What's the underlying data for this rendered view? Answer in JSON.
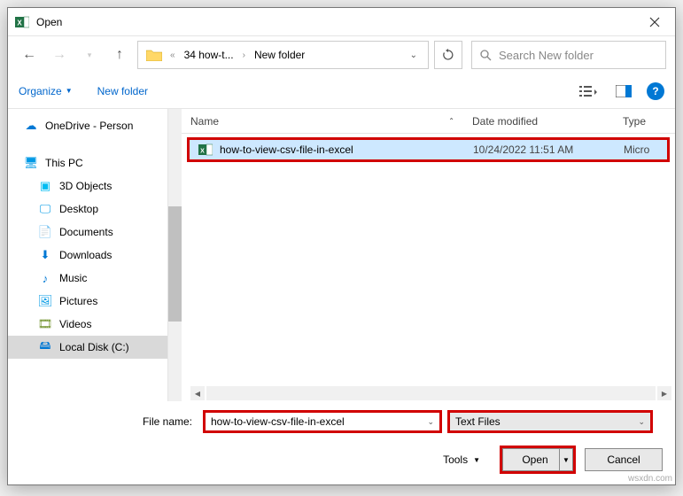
{
  "title": "Open",
  "breadcrumb": {
    "p1": "34 how-t...",
    "p2": "New folder"
  },
  "search": {
    "placeholder": "Search New folder"
  },
  "toolbar": {
    "organize": "Organize",
    "newfolder": "New folder"
  },
  "tree": {
    "onedrive": "OneDrive - Person",
    "thispc": "This PC",
    "threed": "3D Objects",
    "desktop": "Desktop",
    "documents": "Documents",
    "downloads": "Downloads",
    "music": "Music",
    "pictures": "Pictures",
    "videos": "Videos",
    "localdisk": "Local Disk (C:)"
  },
  "headers": {
    "name": "Name",
    "date": "Date modified",
    "type": "Type"
  },
  "file": {
    "name": "how-to-view-csv-file-in-excel",
    "date": "10/24/2022 11:51 AM",
    "type": "Micro"
  },
  "filename_label": "File name:",
  "filename_value": "how-to-view-csv-file-in-excel",
  "filter_value": "Text Files",
  "tools": "Tools",
  "open_btn": "Open",
  "cancel_btn": "Cancel",
  "watermark": "wsxdn.com"
}
